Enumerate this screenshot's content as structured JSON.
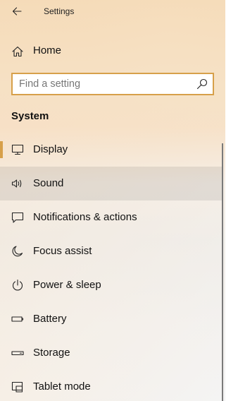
{
  "window": {
    "title": "Settings"
  },
  "home": {
    "label": "Home",
    "icon": "home-icon"
  },
  "search": {
    "placeholder": "Find a setting",
    "value": "",
    "icon": "search-icon"
  },
  "section": {
    "title": "System"
  },
  "nav": {
    "items": [
      {
        "label": "Display",
        "icon": "display-icon",
        "selected": true
      },
      {
        "label": "Sound",
        "icon": "sound-icon",
        "hovered": true
      },
      {
        "label": "Notifications & actions",
        "icon": "notifications-icon"
      },
      {
        "label": "Focus assist",
        "icon": "moon-icon"
      },
      {
        "label": "Power & sleep",
        "icon": "power-icon"
      },
      {
        "label": "Battery",
        "icon": "battery-icon"
      },
      {
        "label": "Storage",
        "icon": "storage-icon"
      },
      {
        "label": "Tablet mode",
        "icon": "tablet-mode-icon"
      }
    ]
  },
  "colors": {
    "accent": "#d7a04a",
    "hover": "#e6e6e6",
    "text": "#111111"
  }
}
